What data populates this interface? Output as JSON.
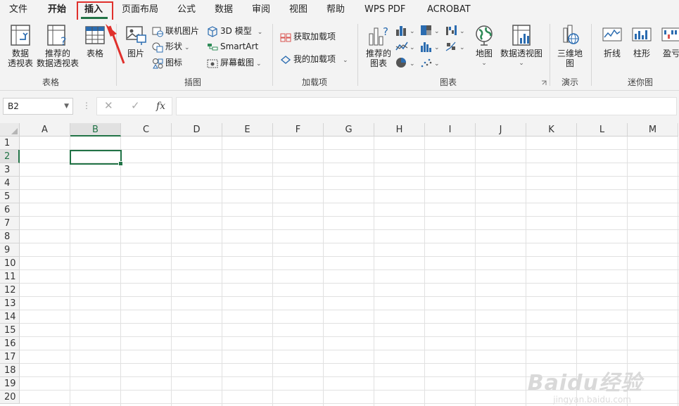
{
  "menu": {
    "items": [
      "文件",
      "开始",
      "插入",
      "页面布局",
      "公式",
      "数据",
      "审阅",
      "视图",
      "帮助",
      "WPS PDF",
      "ACROBAT"
    ],
    "active": "插入"
  },
  "ribbon": {
    "table_group": {
      "label": "表格",
      "pivot_table": "数据\n透视表",
      "recommended_pivot": "推荐的\n数据透视表",
      "table": "表格"
    },
    "illustrations_group": {
      "label": "插图",
      "picture": "图片",
      "online_picture": "联机图片",
      "shapes": "形状",
      "icons": "图标",
      "model_3d": "3D 模型",
      "smartart": "SmartArt",
      "screenshot": "屏幕截图"
    },
    "addins_group": {
      "label": "加载项",
      "get_addins": "获取加载项",
      "my_addins": "我的加载项"
    },
    "charts_group": {
      "label": "图表",
      "recommended_charts": "推荐的\n图表",
      "maps": "地图",
      "pivot_chart": "数据透视图"
    },
    "tours_group": {
      "label": "演示",
      "map_3d": "三维地\n图"
    },
    "sparklines_group": {
      "label": "迷你图",
      "line": "折线",
      "column": "柱形",
      "winloss": "盈亏"
    }
  },
  "formula_bar": {
    "name_box": "B2",
    "cancel": "✕",
    "enter": "✓",
    "fx": "fx",
    "dots": "⋮"
  },
  "sheet": {
    "columns": [
      "A",
      "B",
      "C",
      "D",
      "E",
      "F",
      "G",
      "H",
      "I",
      "J",
      "K",
      "L",
      "M"
    ],
    "rows": [
      "1",
      "2",
      "3",
      "4",
      "5",
      "6",
      "7",
      "8",
      "9",
      "10",
      "11",
      "12",
      "13",
      "14",
      "15",
      "16",
      "17",
      "18",
      "19",
      "20"
    ],
    "selected_column": "B",
    "selected_row": "2"
  },
  "watermark": {
    "brand": "Baidu经验",
    "url": "jingyan.baidu.com"
  },
  "colors": {
    "accent": "#217346",
    "highlight": "#e0302c",
    "icon_blue": "#2b6cb0"
  }
}
